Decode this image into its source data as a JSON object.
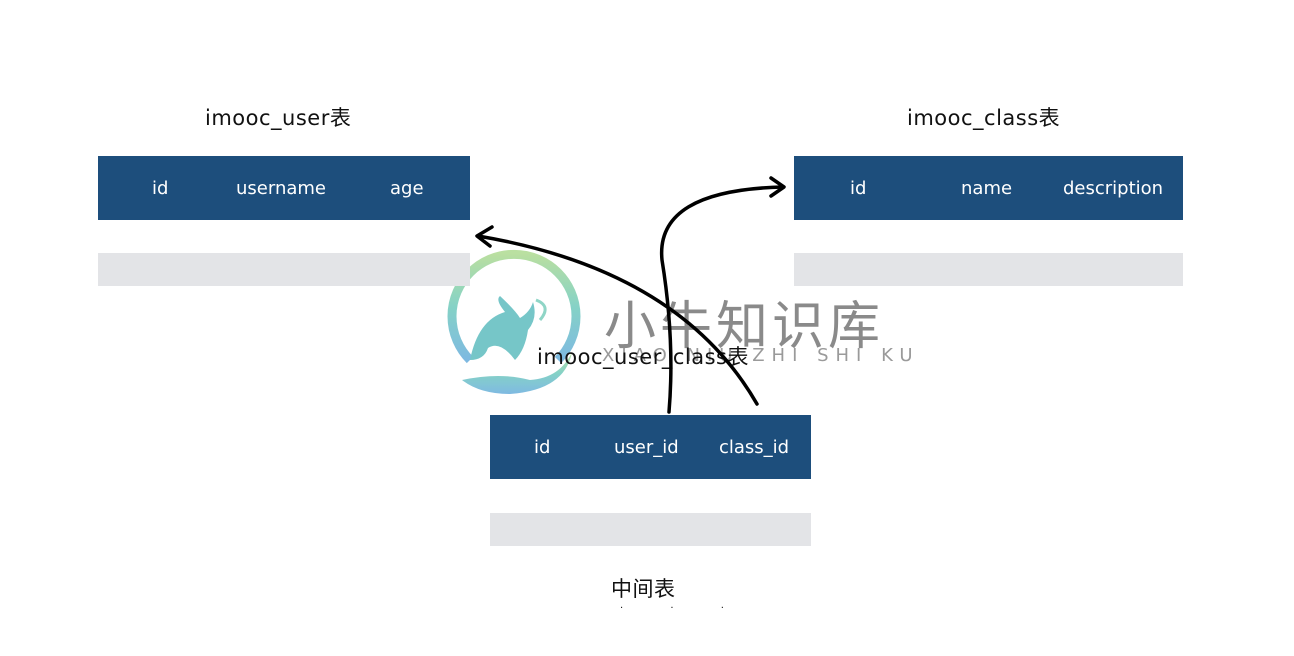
{
  "tables": [
    {
      "title": "imooc_user表",
      "columns": [
        "id",
        "username",
        "age"
      ]
    },
    {
      "title": "imooc_class表",
      "columns": [
        "id",
        "name",
        "description"
      ]
    },
    {
      "title": "imooc_user_class表",
      "columns": [
        "id",
        "user_id",
        "class_id"
      ],
      "caption": "中间表"
    }
  ],
  "relations": [
    {
      "from": "imooc_user_class.class_id",
      "to": "imooc_user"
    },
    {
      "from": "imooc_user_class.user_id",
      "to": "imooc_class"
    }
  ],
  "colors": {
    "header": "#1d4e7c",
    "row": "#e3e4e7"
  },
  "watermark": {
    "title": "小牛知识库",
    "subtitle": "XIAO NIU ZHI SHI KU",
    "logo": "bull-logo-icon"
  },
  "trailing_dots": ". . ."
}
